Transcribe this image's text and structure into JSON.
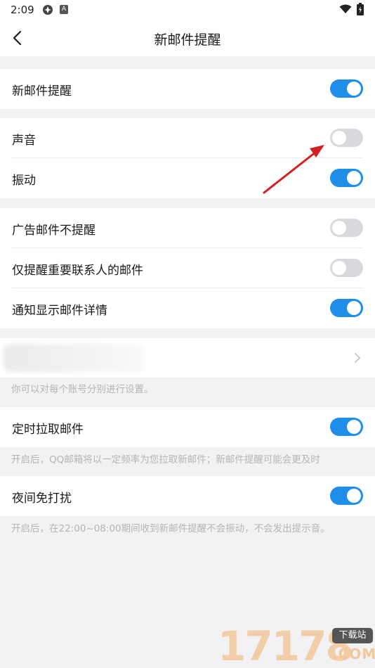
{
  "status_bar": {
    "time": "2:09",
    "app_badge": "A"
  },
  "header": {
    "title": "新邮件提醒"
  },
  "sections": [
    {
      "rows": [
        {
          "label": "新邮件提醒",
          "on": true
        }
      ]
    },
    {
      "rows": [
        {
          "label": "声音",
          "on": false
        },
        {
          "label": "振动",
          "on": true
        }
      ]
    },
    {
      "rows": [
        {
          "label": "广告邮件不提醒",
          "on": false
        },
        {
          "label": "仅提醒重要联系人的邮件",
          "on": false
        },
        {
          "label": "通知显示邮件详情",
          "on": true
        }
      ]
    }
  ],
  "account_note": "你可以对每个账号分别进行设置。",
  "timed_fetch": {
    "label": "定时拉取邮件",
    "on": true,
    "note": "开启后，QQ邮箱将以一定频率为您拉取新邮件；新邮件提醒可能会更及时"
  },
  "night_mode": {
    "label": "夜间免打扰",
    "on": true,
    "note": "开启后，在22:00~08:00期间收到新邮件提醒不会振动，不会发出提示音。"
  },
  "watermark": {
    "digits": "17178",
    "tag": "下载站",
    "suffix": ".COM"
  },
  "colors": {
    "toggle_on": "#1e8ee8",
    "toggle_off": "#d9d9dd",
    "arrow": "#d42020"
  }
}
